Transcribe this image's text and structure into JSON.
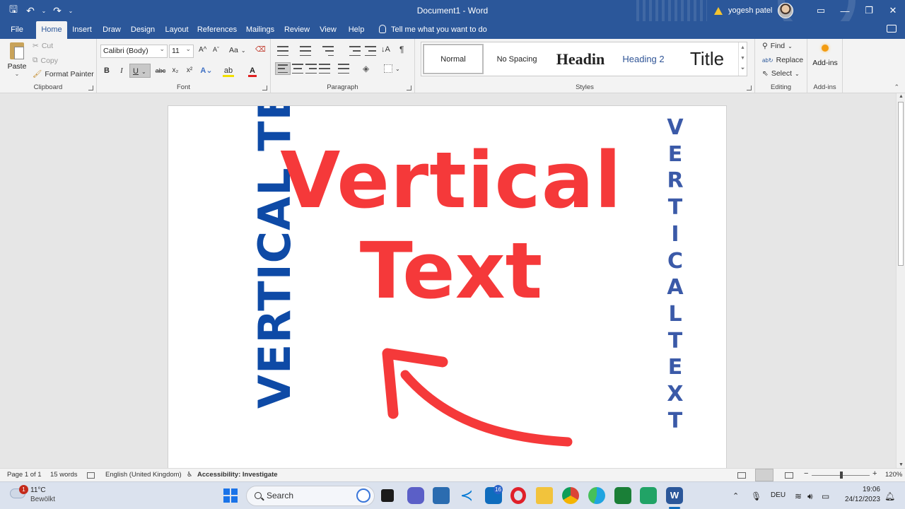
{
  "window": {
    "title": "Document1  -  Word",
    "user_name": "yogesh patel"
  },
  "tabs": [
    "File",
    "Home",
    "Insert",
    "Draw",
    "Design",
    "Layout",
    "References",
    "Mailings",
    "Review",
    "View",
    "Help"
  ],
  "active_tab": "Home",
  "tell_me": "Tell me what you want to do",
  "ribbon": {
    "clipboard": {
      "paste": "Paste",
      "cut": "Cut",
      "copy": "Copy",
      "format_painter": "Format Painter",
      "label": "Clipboard"
    },
    "font": {
      "name": "Calibri (Body)",
      "size": "11",
      "label": "Font",
      "bold": "B",
      "italic": "I",
      "underline": "U",
      "strike": "abc",
      "subscript": "x₂",
      "superscript": "x²",
      "grow": "A^",
      "shrink": "Aˇ",
      "case": "Aa"
    },
    "paragraph": {
      "label": "Paragraph"
    },
    "styles": {
      "label": "Styles",
      "items": [
        "Normal",
        "No Spacing",
        "Headin",
        "Heading 2",
        "Title"
      ]
    },
    "editing": {
      "label": "Editing",
      "find": "Find",
      "replace": "Replace",
      "select": "Select"
    },
    "addins": {
      "button": "Add-ins",
      "label": "Add-ins"
    }
  },
  "document": {
    "rotated_text": "VERTICAL TEXT",
    "big_line1": "Vertical",
    "big_line2": "Text",
    "stacked_letters": [
      "V",
      "E",
      "R",
      "T",
      "I",
      "C",
      "A",
      "L",
      "T",
      "E",
      "X",
      "T"
    ],
    "colors": {
      "red": "#f5393a",
      "blue": "#0e4aa6",
      "stack_blue": "#3b5aa8"
    }
  },
  "statusbar": {
    "page": "Page 1 of 1",
    "words": "15 words",
    "language": "English (United Kingdom)",
    "accessibility": "Accessibility: Investigate",
    "zoom": "120%"
  },
  "taskbar": {
    "weather_temp": "11°C",
    "weather_desc": "Bewölkt",
    "weather_badge": "1",
    "search": "Search",
    "mail_badge": "16",
    "language": "DEU",
    "time": "19:06",
    "date": "24/12/2023"
  }
}
